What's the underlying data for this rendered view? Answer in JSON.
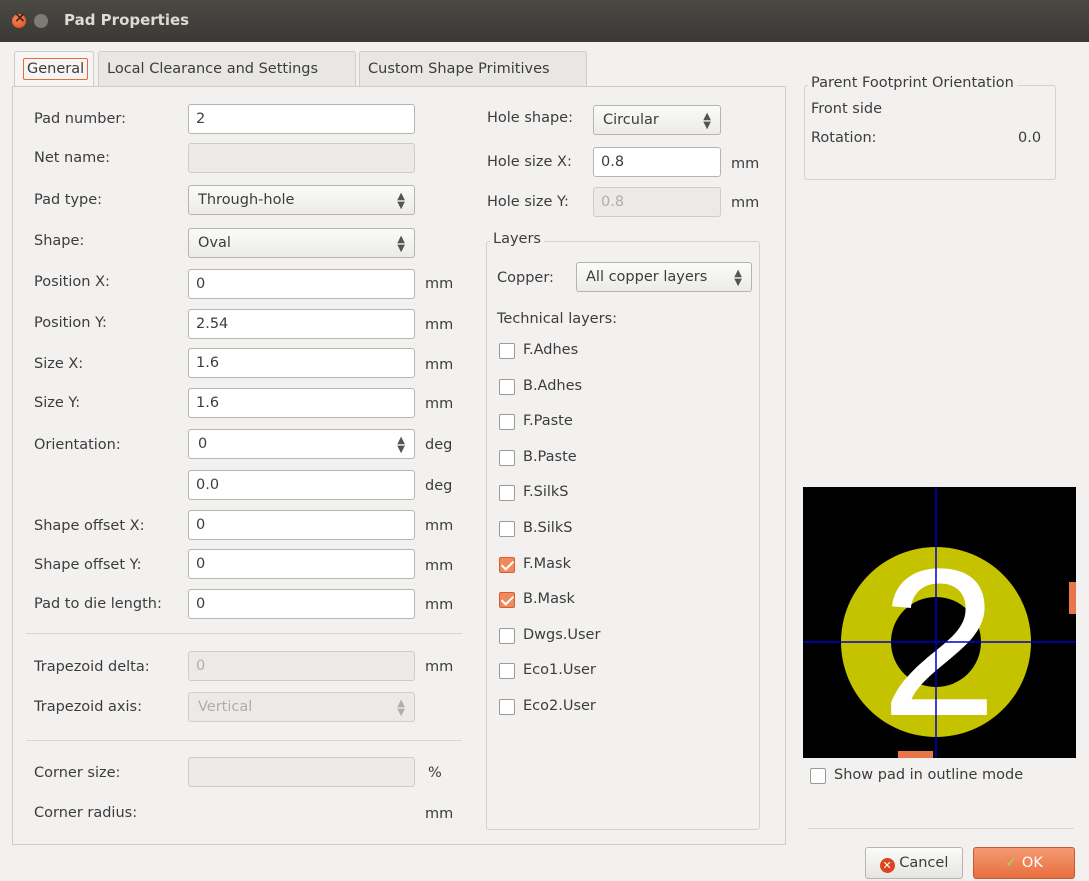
{
  "window": {
    "title": "Pad Properties"
  },
  "tabs": [
    "General",
    "Local Clearance and Settings",
    "Custom Shape Primitives"
  ],
  "general": {
    "pad_number": {
      "label": "Pad number:",
      "value": "2"
    },
    "net_name": {
      "label": "Net name:",
      "value": ""
    },
    "pad_type": {
      "label": "Pad type:",
      "value": "Through-hole"
    },
    "shape": {
      "label": "Shape:",
      "value": "Oval"
    },
    "position_x": {
      "label": "Position X:",
      "value": "0",
      "unit": "mm"
    },
    "position_y": {
      "label": "Position Y:",
      "value": "2.54",
      "unit": "mm"
    },
    "size_x": {
      "label": "Size X:",
      "value": "1.6",
      "unit": "mm"
    },
    "size_y": {
      "label": "Size Y:",
      "value": "1.6",
      "unit": "mm"
    },
    "orientation": {
      "label": "Orientation:",
      "value": "0",
      "unit": "deg",
      "custom_value": "0.0",
      "custom_unit": "deg"
    },
    "shape_offset_x": {
      "label": "Shape offset X:",
      "value": "0",
      "unit": "mm"
    },
    "shape_offset_y": {
      "label": "Shape offset Y:",
      "value": "0",
      "unit": "mm"
    },
    "pad_to_die": {
      "label": "Pad to die length:",
      "value": "0",
      "unit": "mm"
    },
    "trapezoid_delta": {
      "label": "Trapezoid delta:",
      "value": "0",
      "unit": "mm"
    },
    "trapezoid_axis": {
      "label": "Trapezoid axis:",
      "value": "Vertical"
    },
    "corner_size": {
      "label": "Corner size:",
      "value": "",
      "unit": "%"
    },
    "corner_radius": {
      "label": "Corner radius:",
      "unit": "mm"
    }
  },
  "hole": {
    "shape": {
      "label": "Hole shape:",
      "value": "Circular"
    },
    "size_x": {
      "label": "Hole size X:",
      "value": "0.8",
      "unit": "mm"
    },
    "size_y": {
      "label": "Hole size Y:",
      "value": "0.8",
      "unit": "mm"
    }
  },
  "layers": {
    "title": "Layers",
    "copper_label": "Copper:",
    "copper_value": "All copper layers",
    "technical_label": "Technical layers:",
    "items": [
      {
        "name": "F.Adhes",
        "checked": false
      },
      {
        "name": "B.Adhes",
        "checked": false
      },
      {
        "name": "F.Paste",
        "checked": false
      },
      {
        "name": "B.Paste",
        "checked": false
      },
      {
        "name": "F.SilkS",
        "checked": false
      },
      {
        "name": "B.SilkS",
        "checked": false
      },
      {
        "name": "F.Mask",
        "checked": true
      },
      {
        "name": "B.Mask",
        "checked": true
      },
      {
        "name": "Dwgs.User",
        "checked": false
      },
      {
        "name": "Eco1.User",
        "checked": false
      },
      {
        "name": "Eco2.User",
        "checked": false
      }
    ]
  },
  "parent_footprint": {
    "title": "Parent Footprint Orientation",
    "side": "Front side",
    "rotation_label": "Rotation:",
    "rotation_value": "0.0"
  },
  "preview": {
    "pad_label": "2",
    "pad_color": "#c5c300",
    "outline_label": "Show pad in outline mode",
    "outline_checked": false
  },
  "buttons": {
    "cancel": "Cancel",
    "ok": "OK"
  }
}
